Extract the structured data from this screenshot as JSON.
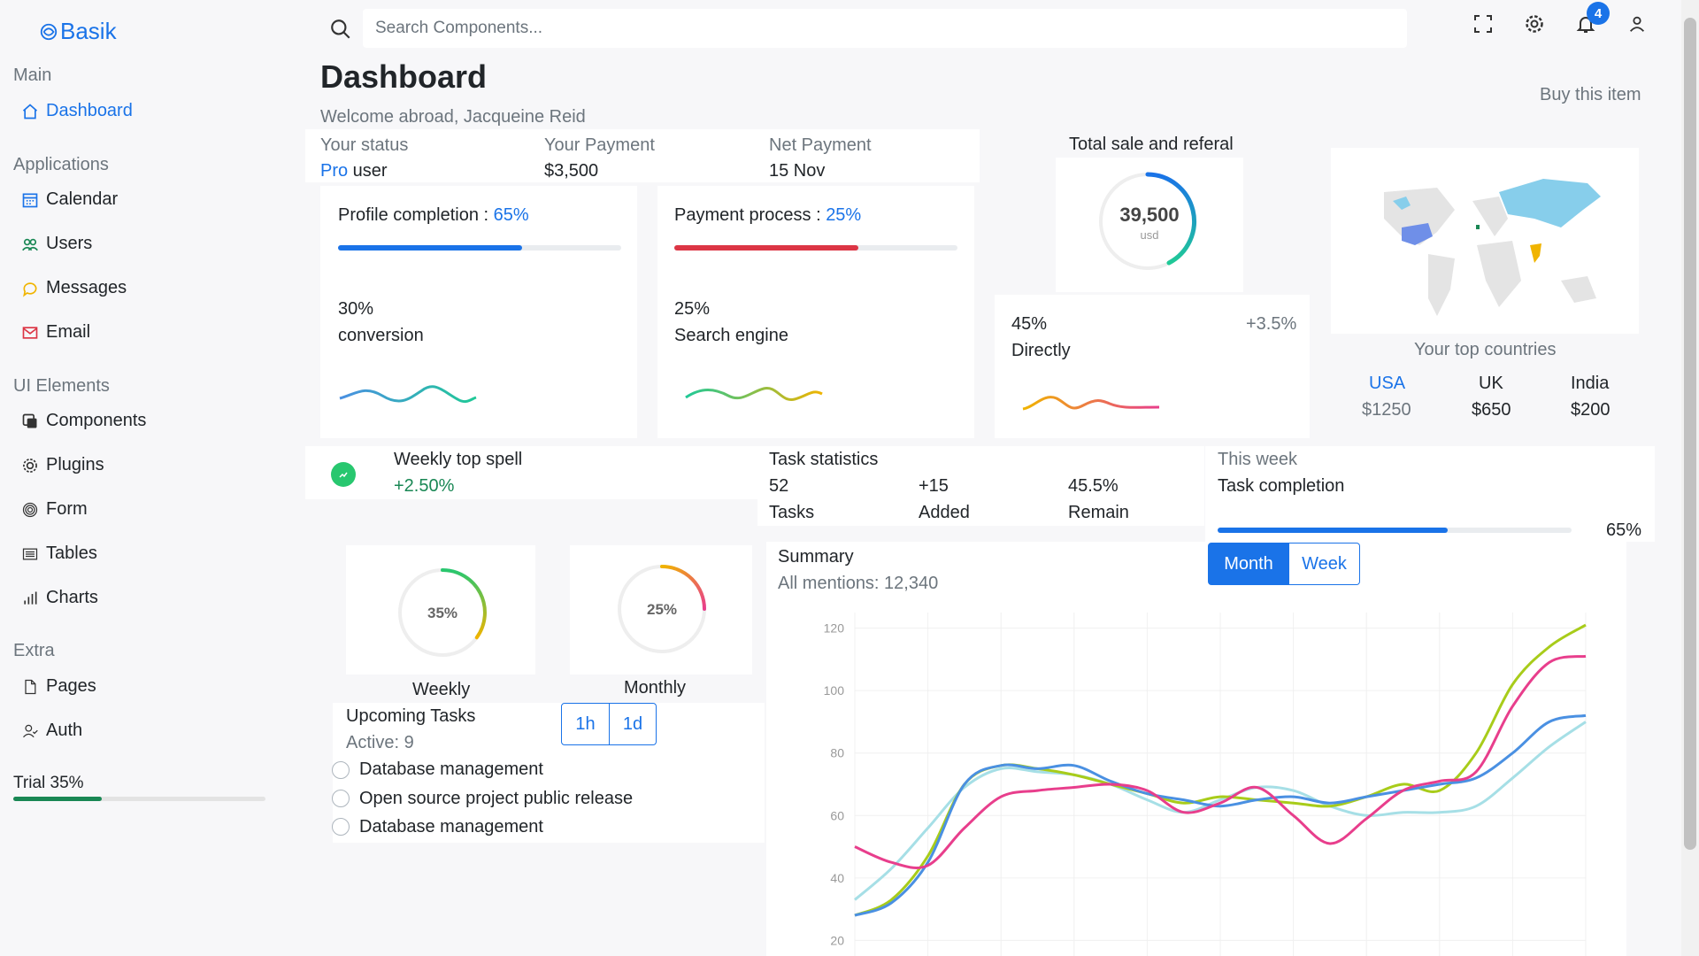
{
  "brand": "Basik",
  "sidebar": {
    "main_title": "Main",
    "dashboard": "Dashboard",
    "apps_title": "Applications",
    "calendar": "Calendar",
    "users": "Users",
    "messages": "Messages",
    "email": "Email",
    "ui_title": "UI Elements",
    "components": "Components",
    "plugins": "Plugins",
    "form": "Form",
    "tables": "Tables",
    "charts": "Charts",
    "extra_title": "Extra",
    "pages": "Pages",
    "auth": "Auth",
    "trial_label": "Trial 35%",
    "trial_progress": 0.35
  },
  "topbar": {
    "search_placeholder": "Search Components...",
    "notification_count": "4",
    "icons": [
      "fullscreen-icon",
      "gear-icon",
      "bell-icon",
      "user-icon"
    ]
  },
  "page": {
    "title": "Dashboard",
    "subtitle": "Welcome abroad, Jacqueine Reid",
    "buy": "Buy this item"
  },
  "status": {
    "status_label": "Your status",
    "status_value_highlight": "Pro",
    "status_value_rest": " user",
    "payment_label": "Your Payment",
    "payment_value": "$3,500",
    "net_label": "Net Payment",
    "net_value": "15 Nov"
  },
  "profile": {
    "label": "Profile completion : ",
    "percent": "65%",
    "progress": 0.65,
    "stat_value": "30%",
    "stat_label": "conversion"
  },
  "payment": {
    "label": "Payment process : ",
    "percent": "25%",
    "progress": 0.65,
    "stat_value": "25%",
    "stat_label": "Search engine"
  },
  "total_sale": {
    "title": "Total sale and referal",
    "amount": "39,500",
    "unit": "usd",
    "stat_value": "45%",
    "stat_label": "Directly",
    "change": "+3.5%"
  },
  "countries": {
    "title": "Your top countries",
    "items": [
      {
        "name": "USA",
        "value": "$1250"
      },
      {
        "name": "UK",
        "value": "$650"
      },
      {
        "name": "India",
        "value": "$200"
      }
    ]
  },
  "weekly_spell": {
    "title": "Weekly top spell",
    "value": "+2.50%"
  },
  "task_stats": {
    "title": "Task statistics",
    "items": [
      {
        "value": "52",
        "label": "Tasks"
      },
      {
        "value": "+15",
        "label": "Added"
      },
      {
        "value": "45.5%",
        "label": "Remain"
      }
    ]
  },
  "this_week": {
    "label": "This week",
    "title": "Task completion",
    "percent": "65%",
    "progress": 0.65
  },
  "rings": {
    "weekly_value": "35%",
    "weekly_label": "Weekly",
    "weekly_progress": 0.35,
    "monthly_value": "25%",
    "monthly_label": "Monthly",
    "monthly_progress": 0.25
  },
  "upcoming": {
    "title": "Upcoming Tasks",
    "active": "Active: 9",
    "btn_1h": "1h",
    "btn_1d": "1d",
    "tasks": [
      "Database management",
      "Open source project public release",
      "Database management"
    ]
  },
  "summary": {
    "title": "Summary",
    "mentions": "All mentions: 12,340",
    "btn_month": "Month",
    "btn_week": "Week"
  },
  "chart_data": {
    "type": "line",
    "ylim": [
      15,
      125
    ],
    "yticks": [
      120,
      100,
      80,
      60,
      40,
      20
    ],
    "x": [
      0,
      1,
      2,
      3,
      4,
      5,
      6,
      7,
      8,
      9,
      10,
      11,
      12,
      13,
      14,
      15,
      16,
      17,
      18,
      19,
      20
    ],
    "series": [
      {
        "color": "#e83e8c",
        "values": [
          50,
          45,
          44,
          56,
          66,
          68,
          69,
          70,
          68,
          61,
          64,
          69,
          60,
          51,
          59,
          68,
          71,
          74,
          95,
          109,
          111
        ]
      },
      {
        "color": "#4a90e2",
        "values": [
          28,
          32,
          45,
          70,
          76,
          75,
          76,
          71,
          67,
          65,
          63,
          65,
          66,
          64,
          66,
          68,
          70,
          72,
          80,
          90,
          92
        ]
      },
      {
        "color": "#a8cc1a",
        "values": [
          28,
          33,
          47,
          70,
          76,
          75,
          73,
          70,
          67,
          64,
          66,
          65,
          64,
          63,
          66,
          70,
          68,
          80,
          102,
          114,
          121
        ]
      },
      {
        "color": "#a6dfe6",
        "values": [
          33,
          43,
          56,
          69,
          75,
          74,
          73,
          70,
          65,
          61,
          65,
          69,
          68,
          63,
          60,
          61,
          61,
          63,
          72,
          82,
          90
        ]
      }
    ]
  },
  "colors": {
    "primary": "#1a73e8",
    "danger": "#dc3545",
    "success": "#198754"
  }
}
